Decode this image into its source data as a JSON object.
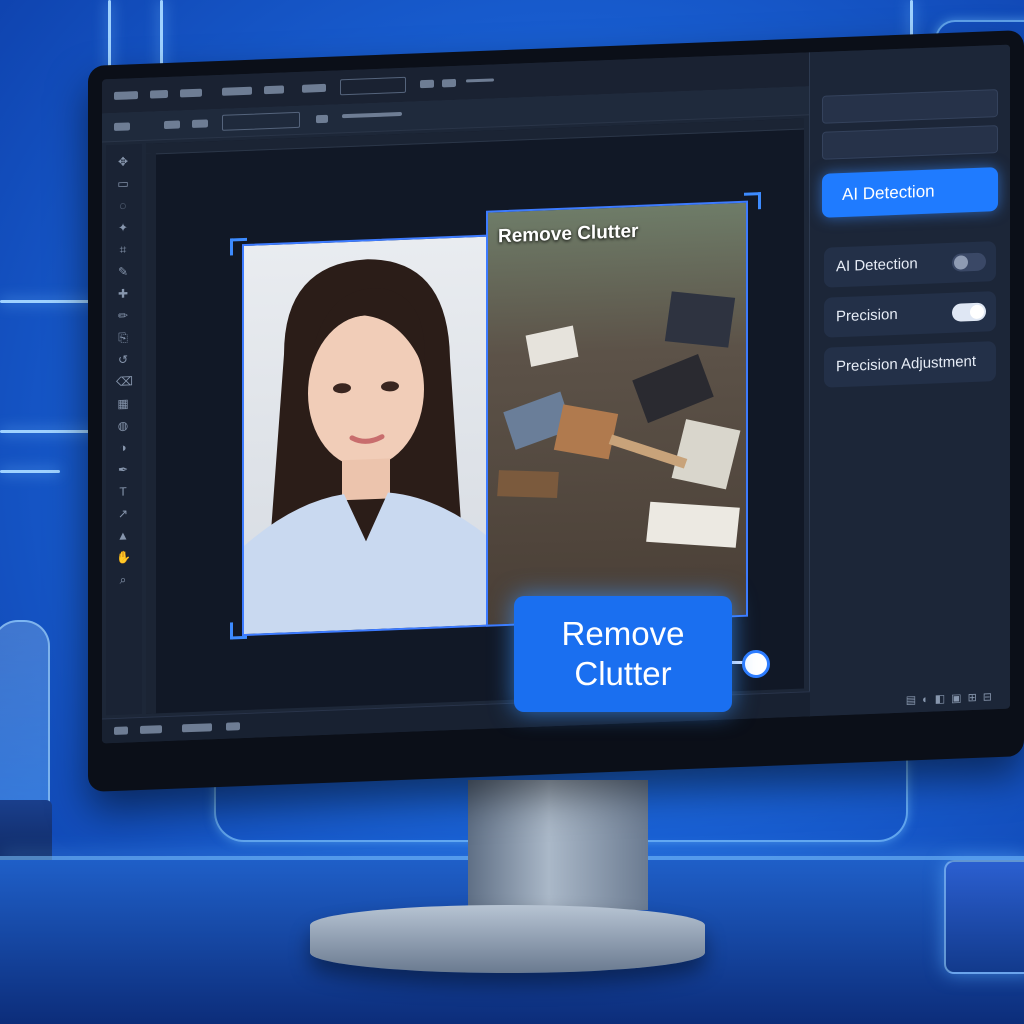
{
  "scene": {
    "accent_color": "#1f7bff",
    "background_color": "#1a62d6"
  },
  "editor": {
    "image_overlay_title": "Remove Clutter",
    "callout": {
      "line1": "Remove",
      "line2": "Clutter"
    },
    "panel": {
      "header_label": "",
      "primary_button": "AI Detection",
      "rows": [
        {
          "label": "AI Detection",
          "toggle_on": false
        },
        {
          "label": "Precision",
          "toggle_on": true
        },
        {
          "label": "Precision Adjustment",
          "toggle_on": null
        }
      ]
    },
    "icons": {
      "left_toolbar": [
        "move-icon",
        "marquee-icon",
        "lasso-icon",
        "magic-wand-icon",
        "crop-icon",
        "eyedropper-icon",
        "healing-icon",
        "brush-icon",
        "stamp-icon",
        "history-icon",
        "eraser-icon",
        "gradient-icon",
        "blur-icon",
        "dodge-icon",
        "pen-icon",
        "text-icon",
        "path-icon",
        "shape-icon",
        "hand-icon",
        "zoom-icon"
      ],
      "panel_bottom": [
        "layers-icon",
        "adjust-icon",
        "mask-icon",
        "group-icon",
        "new-layer-icon",
        "delete-icon"
      ]
    }
  }
}
